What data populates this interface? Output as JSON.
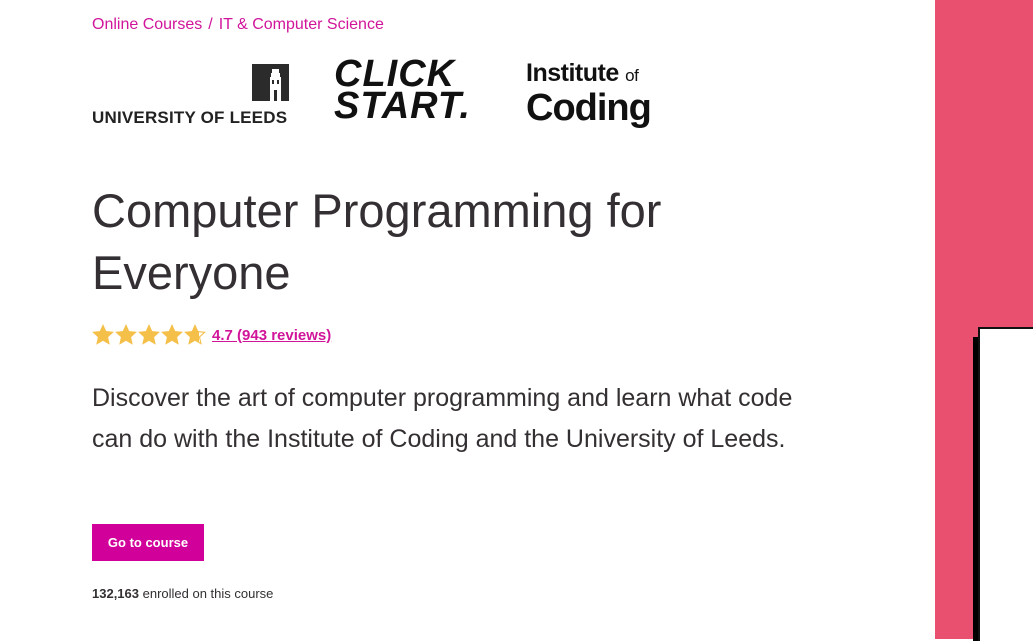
{
  "breadcrumb": {
    "items": [
      "Online Courses",
      "IT & Computer Science"
    ],
    "separator": "/"
  },
  "logos": {
    "leeds": "UNIVERSITY OF LEEDS",
    "clickstart_line1": "CLICK",
    "clickstart_line2": "START.",
    "ioc_line1": "Institute",
    "ioc_of": "of",
    "ioc_line2": "Coding"
  },
  "course": {
    "title": "Computer Programming for Everyone",
    "rating": 4.7,
    "rating_text": "4.7 (943 reviews)",
    "description": "Discover the art of computer programming and learn what code can do with the Institute of Coding and the University of Leeds.",
    "cta_label": "Go to course",
    "enrolled_count": "132,163",
    "enrolled_suffix": " enrolled on this course"
  },
  "colors": {
    "accent": "#d1009a",
    "link": "#d1159a",
    "star": "#f5c04a",
    "hero_panel": "#e94f6e",
    "text": "#332f33"
  }
}
